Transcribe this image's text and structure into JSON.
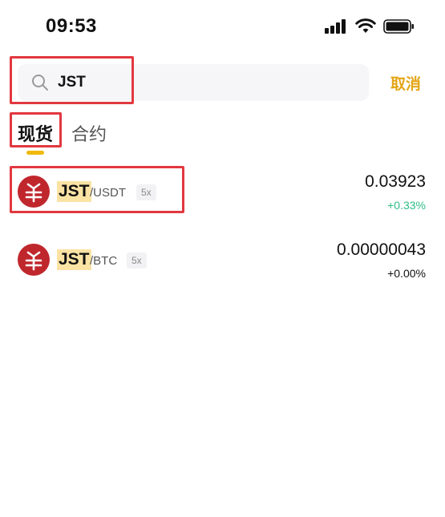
{
  "status_bar": {
    "time": "09:53"
  },
  "search": {
    "query": "JST",
    "cancel_label": "取消"
  },
  "tabs": [
    {
      "label": "现货",
      "active": true
    },
    {
      "label": "合约",
      "active": false
    }
  ],
  "pairs": [
    {
      "base": "JST",
      "quote": "/USDT",
      "leverage": "5x",
      "price": "0.03923",
      "change": "+0.33%",
      "change_direction": "up"
    },
    {
      "base": "JST",
      "quote": "/BTC",
      "leverage": "5x",
      "price": "0.00000043",
      "change": "+0.00%",
      "change_direction": "flat"
    }
  ],
  "colors": {
    "accent": "#f0b90b",
    "cancel": "#e4a514",
    "up": "#2ebd85",
    "annotation": "#e2383f",
    "coin": "#c0272d"
  }
}
